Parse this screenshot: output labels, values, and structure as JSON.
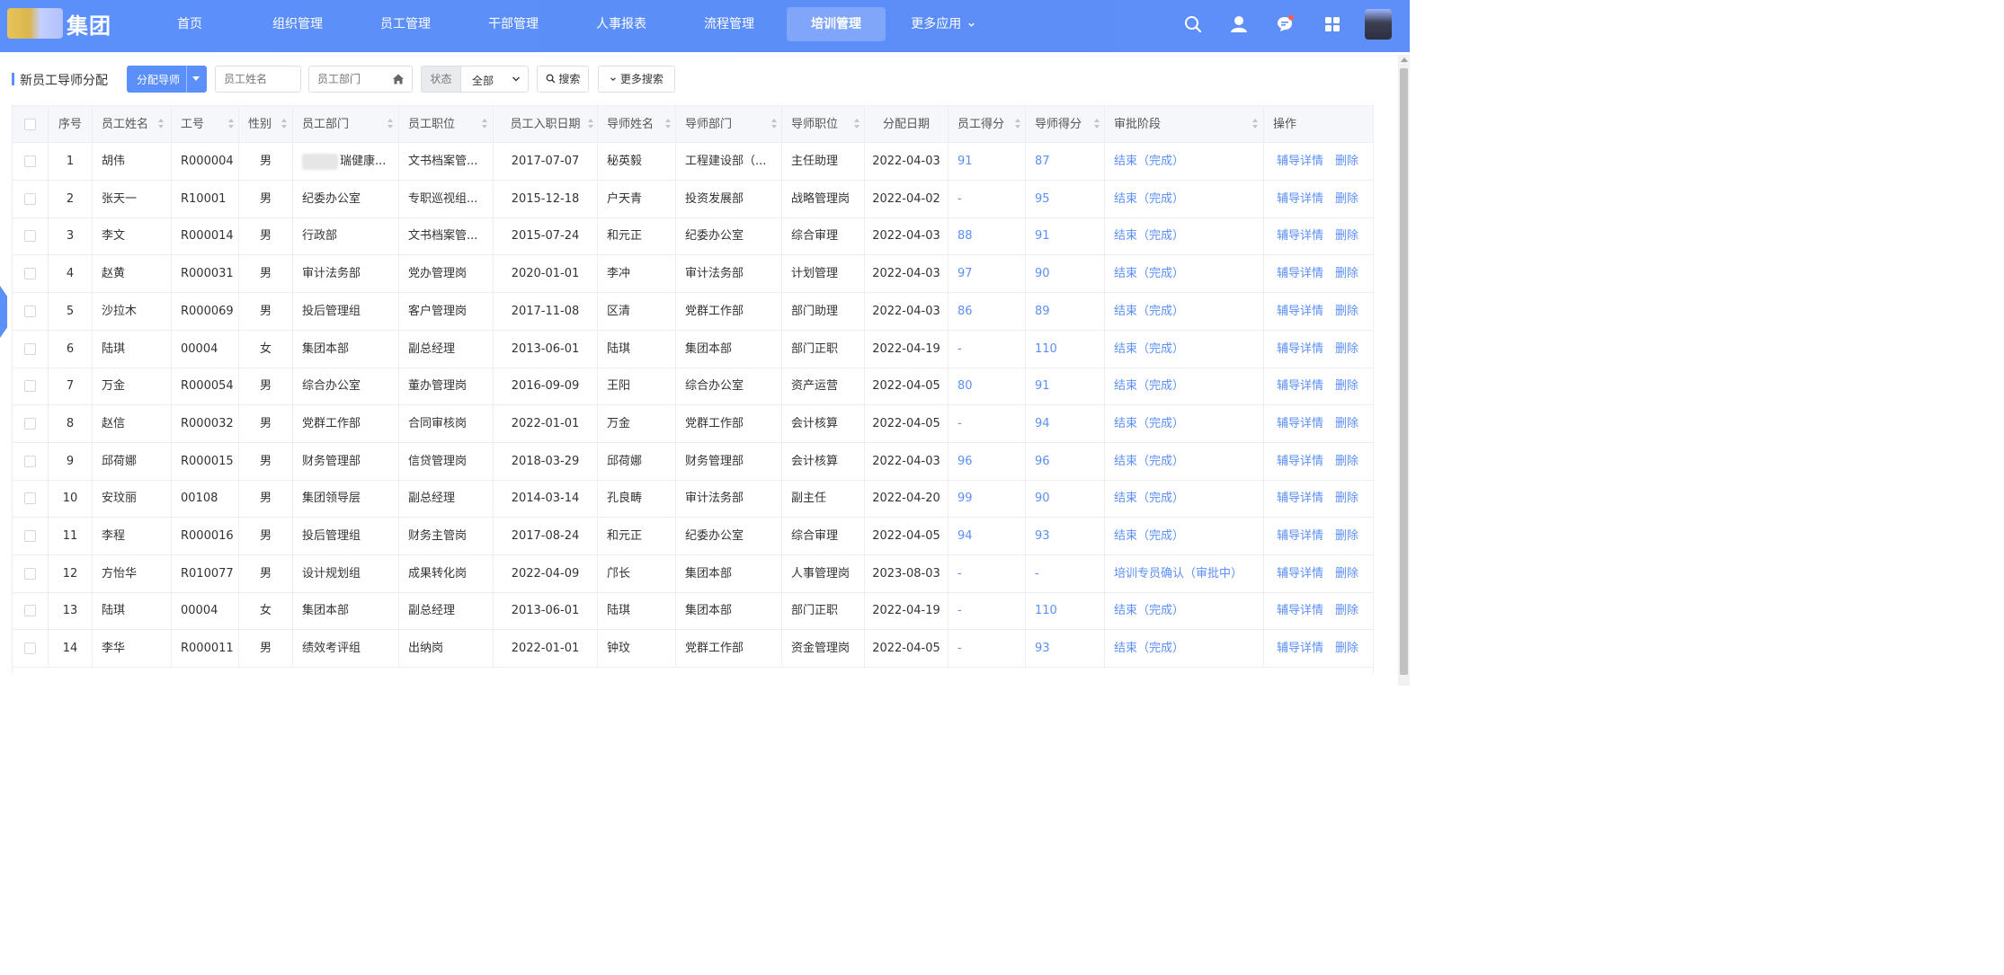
{
  "brand": {
    "name": "集团"
  },
  "nav": {
    "items": [
      {
        "label": "首页"
      },
      {
        "label": "组织管理"
      },
      {
        "label": "员工管理"
      },
      {
        "label": "干部管理"
      },
      {
        "label": "人事报表"
      },
      {
        "label": "流程管理"
      },
      {
        "label": "培训管理",
        "active": true
      },
      {
        "label": "更多应用"
      }
    ]
  },
  "toolbar": {
    "page_title": "新员工导师分配",
    "assign_label": "分配导师",
    "name_placeholder": "员工姓名",
    "dept_placeholder": "员工部门",
    "status_label": "状态",
    "status_value": "全部",
    "search_label": "搜索",
    "more_search_label": "更多搜索"
  },
  "table": {
    "headers": {
      "index": "序号",
      "name": "员工姓名",
      "id": "工号",
      "gender": "性别",
      "dept": "员工部门",
      "position": "员工职位",
      "join_date": "员工入职日期",
      "mentor": "导师姓名",
      "mentor_dept": "导师部门",
      "mentor_pos": "导师职位",
      "assign_date": "分配日期",
      "emp_score": "员工得分",
      "mentor_score": "导师得分",
      "stage": "审批阶段",
      "ops": "操作"
    },
    "action_detail": "辅导详情",
    "action_delete": "删除",
    "rows": [
      {
        "index": "1",
        "name": "胡伟",
        "id": "R000004",
        "gender": "男",
        "dept": "瑞健康...",
        "position": "文书档案管...",
        "join_date": "2017-07-07",
        "mentor": "秘英毅",
        "mentor_dept": "工程建设部（...",
        "mentor_pos": "主任助理",
        "assign_date": "2022-04-03",
        "emp_score": "91",
        "mentor_score": "87",
        "stage": "结束（完成）"
      },
      {
        "index": "2",
        "name": "张天一",
        "id": "R10001",
        "gender": "男",
        "dept": "纪委办公室",
        "position": "专职巡视组...",
        "join_date": "2015-12-18",
        "mentor": "户天青",
        "mentor_dept": "投资发展部",
        "mentor_pos": "战略管理岗",
        "assign_date": "2022-04-02",
        "emp_score": "-",
        "mentor_score": "95",
        "stage": "结束（完成）"
      },
      {
        "index": "3",
        "name": "李文",
        "id": "R000014",
        "gender": "男",
        "dept": "行政部",
        "position": "文书档案管...",
        "join_date": "2015-07-24",
        "mentor": "和元正",
        "mentor_dept": "纪委办公室",
        "mentor_pos": "综合审理",
        "assign_date": "2022-04-03",
        "emp_score": "88",
        "mentor_score": "91",
        "stage": "结束（完成）"
      },
      {
        "index": "4",
        "name": "赵黄",
        "id": "R000031",
        "gender": "男",
        "dept": "审计法务部",
        "position": "党办管理岗",
        "join_date": "2020-01-01",
        "mentor": "李冲",
        "mentor_dept": "审计法务部",
        "mentor_pos": "计划管理",
        "assign_date": "2022-04-03",
        "emp_score": "97",
        "mentor_score": "90",
        "stage": "结束（完成）"
      },
      {
        "index": "5",
        "name": "沙拉木",
        "id": "R000069",
        "gender": "男",
        "dept": "投后管理组",
        "position": "客户管理岗",
        "join_date": "2017-11-08",
        "mentor": "区清",
        "mentor_dept": "党群工作部",
        "mentor_pos": "部门助理",
        "assign_date": "2022-04-03",
        "emp_score": "86",
        "mentor_score": "89",
        "stage": "结束（完成）"
      },
      {
        "index": "6",
        "name": "陆琪",
        "id": "00004",
        "gender": "女",
        "dept": "集团本部",
        "position": "副总经理",
        "join_date": "2013-06-01",
        "mentor": "陆琪",
        "mentor_dept": "集团本部",
        "mentor_pos": "部门正职",
        "assign_date": "2022-04-19",
        "emp_score": "-",
        "mentor_score": "110",
        "stage": "结束（完成）"
      },
      {
        "index": "7",
        "name": "万金",
        "id": "R000054",
        "gender": "男",
        "dept": "综合办公室",
        "position": "董办管理岗",
        "join_date": "2016-09-09",
        "mentor": "王阳",
        "mentor_dept": "综合办公室",
        "mentor_pos": "资产运营",
        "assign_date": "2022-04-05",
        "emp_score": "80",
        "mentor_score": "91",
        "stage": "结束（完成）"
      },
      {
        "index": "8",
        "name": "赵信",
        "id": "R000032",
        "gender": "男",
        "dept": "党群工作部",
        "position": "合同审核岗",
        "join_date": "2022-01-01",
        "mentor": "万金",
        "mentor_dept": "党群工作部",
        "mentor_pos": "会计核算",
        "assign_date": "2022-04-05",
        "emp_score": "-",
        "mentor_score": "94",
        "stage": "结束（完成）"
      },
      {
        "index": "9",
        "name": "邱荷娜",
        "id": "R000015",
        "gender": "男",
        "dept": "财务管理部",
        "position": "信贷管理岗",
        "join_date": "2018-03-29",
        "mentor": "邱荷娜",
        "mentor_dept": "财务管理部",
        "mentor_pos": "会计核算",
        "assign_date": "2022-04-03",
        "emp_score": "96",
        "mentor_score": "96",
        "stage": "结束（完成）"
      },
      {
        "index": "10",
        "name": "安玟丽",
        "id": "00108",
        "gender": "男",
        "dept": "集团领导层",
        "position": "副总经理",
        "join_date": "2014-03-14",
        "mentor": "孔良畴",
        "mentor_dept": "审计法务部",
        "mentor_pos": "副主任",
        "assign_date": "2022-04-20",
        "emp_score": "99",
        "mentor_score": "90",
        "stage": "结束（完成）"
      },
      {
        "index": "11",
        "name": "李程",
        "id": "R000016",
        "gender": "男",
        "dept": "投后管理组",
        "position": "财务主管岗",
        "join_date": "2017-08-24",
        "mentor": "和元正",
        "mentor_dept": "纪委办公室",
        "mentor_pos": "综合审理",
        "assign_date": "2022-04-05",
        "emp_score": "94",
        "mentor_score": "93",
        "stage": "结束（完成）"
      },
      {
        "index": "12",
        "name": "方怡华",
        "id": "R010077",
        "gender": "男",
        "dept": "设计规划组",
        "position": "成果转化岗",
        "join_date": "2022-04-09",
        "mentor": "邝长",
        "mentor_dept": "集团本部",
        "mentor_pos": "人事管理岗",
        "assign_date": "2023-08-03",
        "emp_score": "-",
        "mentor_score": "-",
        "stage": "培训专员确认（审批中）"
      },
      {
        "index": "13",
        "name": "陆琪",
        "id": "00004",
        "gender": "女",
        "dept": "集团本部",
        "position": "副总经理",
        "join_date": "2013-06-01",
        "mentor": "陆琪",
        "mentor_dept": "集团本部",
        "mentor_pos": "部门正职",
        "assign_date": "2022-04-19",
        "emp_score": "-",
        "mentor_score": "110",
        "stage": "结束（完成）"
      },
      {
        "index": "14",
        "name": "李华",
        "id": "R000011",
        "gender": "男",
        "dept": "绩效考评组",
        "position": "出纳岗",
        "join_date": "2022-01-01",
        "mentor": "钟玟",
        "mentor_dept": "党群工作部",
        "mentor_pos": "资金管理岗",
        "assign_date": "2022-04-05",
        "emp_score": "-",
        "mentor_score": "93",
        "stage": "结束（完成）"
      }
    ]
  },
  "colors": {
    "primary": "#5b8ff9",
    "header_bg": "#f5f7fa",
    "border": "#ebeef5"
  }
}
